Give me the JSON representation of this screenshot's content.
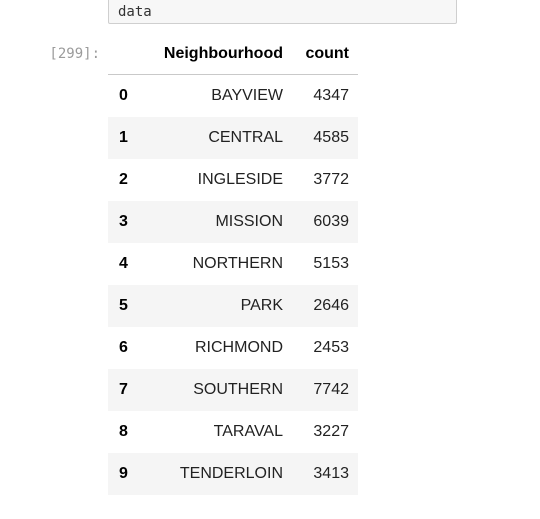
{
  "input_cell": {
    "code": "data"
  },
  "output_cell": {
    "prompt": "[299]:",
    "columns": [
      "",
      "Neighbourhood",
      "count"
    ],
    "rows": [
      {
        "index": "0",
        "neighbourhood": "BAYVIEW",
        "count": "4347"
      },
      {
        "index": "1",
        "neighbourhood": "CENTRAL",
        "count": "4585"
      },
      {
        "index": "2",
        "neighbourhood": "INGLESIDE",
        "count": "3772"
      },
      {
        "index": "3",
        "neighbourhood": "MISSION",
        "count": "6039"
      },
      {
        "index": "4",
        "neighbourhood": "NORTHERN",
        "count": "5153"
      },
      {
        "index": "5",
        "neighbourhood": "PARK",
        "count": "2646"
      },
      {
        "index": "6",
        "neighbourhood": "RICHMOND",
        "count": "2453"
      },
      {
        "index": "7",
        "neighbourhood": "SOUTHERN",
        "count": "7742"
      },
      {
        "index": "8",
        "neighbourhood": "TARAVAL",
        "count": "3227"
      },
      {
        "index": "9",
        "neighbourhood": "TENDERLOIN",
        "count": "3413"
      }
    ]
  },
  "colors": {
    "stripe": "#f5f5f5",
    "prompt": "#9b9b9b",
    "input_background": "#f7f7f7"
  }
}
